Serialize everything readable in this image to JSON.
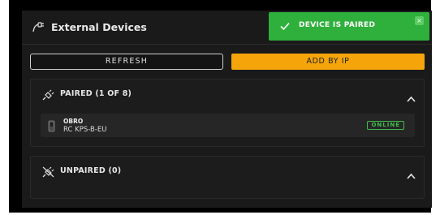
{
  "header": {
    "title": "External Devices",
    "icon": "plug-icon"
  },
  "toast": {
    "message": "DEVICE IS PAIRED",
    "color": "#2fb03c",
    "close_label": "×"
  },
  "buttons": {
    "refresh_label": "REFRESH",
    "add_label": "ADD BY IP",
    "accent": "#f5a40a"
  },
  "paired": {
    "title": "PAIRED (1 OF 8)",
    "devices": [
      {
        "name": "OBRO",
        "model": "RC KPS-B-EU",
        "status": "ONLINE"
      }
    ]
  },
  "unpaired": {
    "title": "UNPAIRED (0)"
  }
}
